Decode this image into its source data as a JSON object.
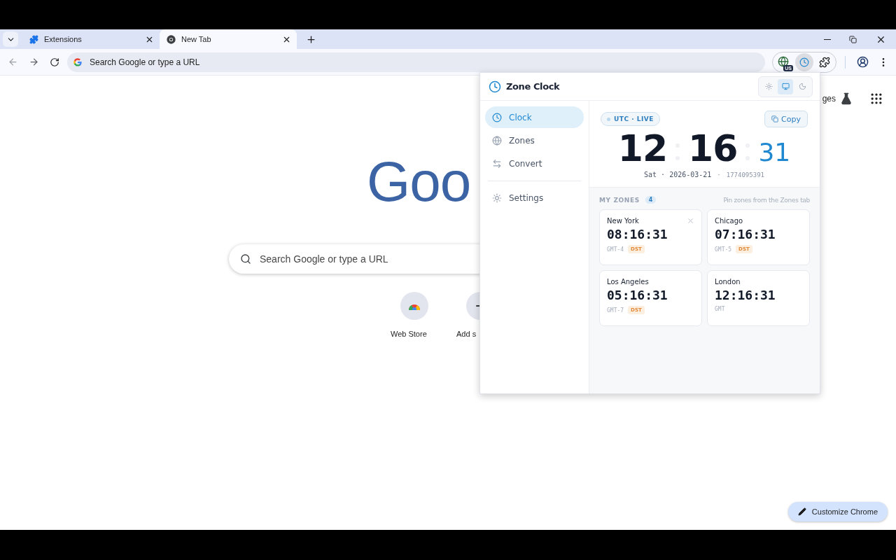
{
  "browser": {
    "tabs": [
      {
        "title": "Extensions",
        "kind": "extensions",
        "selected": false
      },
      {
        "title": "New Tab",
        "kind": "chrome",
        "selected": true
      }
    ],
    "address": {
      "placeholder": "Search Google or type a URL"
    },
    "extension_badge": "US"
  },
  "page": {
    "google_logo": "Goo",
    "header_link": "ges",
    "search": {
      "placeholder": "Search Google or type a URL"
    },
    "shortcuts": [
      {
        "label": "Web Store",
        "kind": "store"
      },
      {
        "label": "Add s",
        "kind": "add"
      }
    ],
    "customize_button": "Customize Chrome"
  },
  "popup": {
    "title": "Zone Clock",
    "theme_options": [
      {
        "kind": "light",
        "selected": false
      },
      {
        "kind": "system",
        "selected": true
      },
      {
        "kind": "dark",
        "selected": false
      }
    ],
    "nav": [
      {
        "label": "Clock",
        "kind": "clock",
        "selected": true
      },
      {
        "label": "Zones",
        "kind": "zones",
        "selected": false
      },
      {
        "label": "Convert",
        "kind": "convert",
        "selected": false
      },
      {
        "label": "Settings",
        "kind": "settings",
        "selected": false
      }
    ],
    "clock": {
      "chip": "UTC · LIVE",
      "copy_button": "Copy",
      "hours": "12",
      "minutes": "16",
      "seconds": "31",
      "date": "Sat · 2026-03-21",
      "separator": "·",
      "epoch": "1774095391"
    },
    "zones": {
      "title": "MY ZONES",
      "count": "4",
      "hint": "Pin zones from the Zones tab",
      "cards": [
        {
          "city": "New York",
          "time": "08:16:31",
          "offset": "GMT-4",
          "dst_label": "DST",
          "removable": true
        },
        {
          "city": "Chicago",
          "time": "07:16:31",
          "offset": "GMT-5",
          "dst_label": "DST",
          "removable": false
        },
        {
          "city": "Los Angeles",
          "time": "05:16:31",
          "offset": "GMT-7",
          "dst_label": "DST",
          "removable": false
        },
        {
          "city": "London",
          "time": "12:16:31",
          "offset": "GMT",
          "removable": false
        }
      ]
    }
  }
}
